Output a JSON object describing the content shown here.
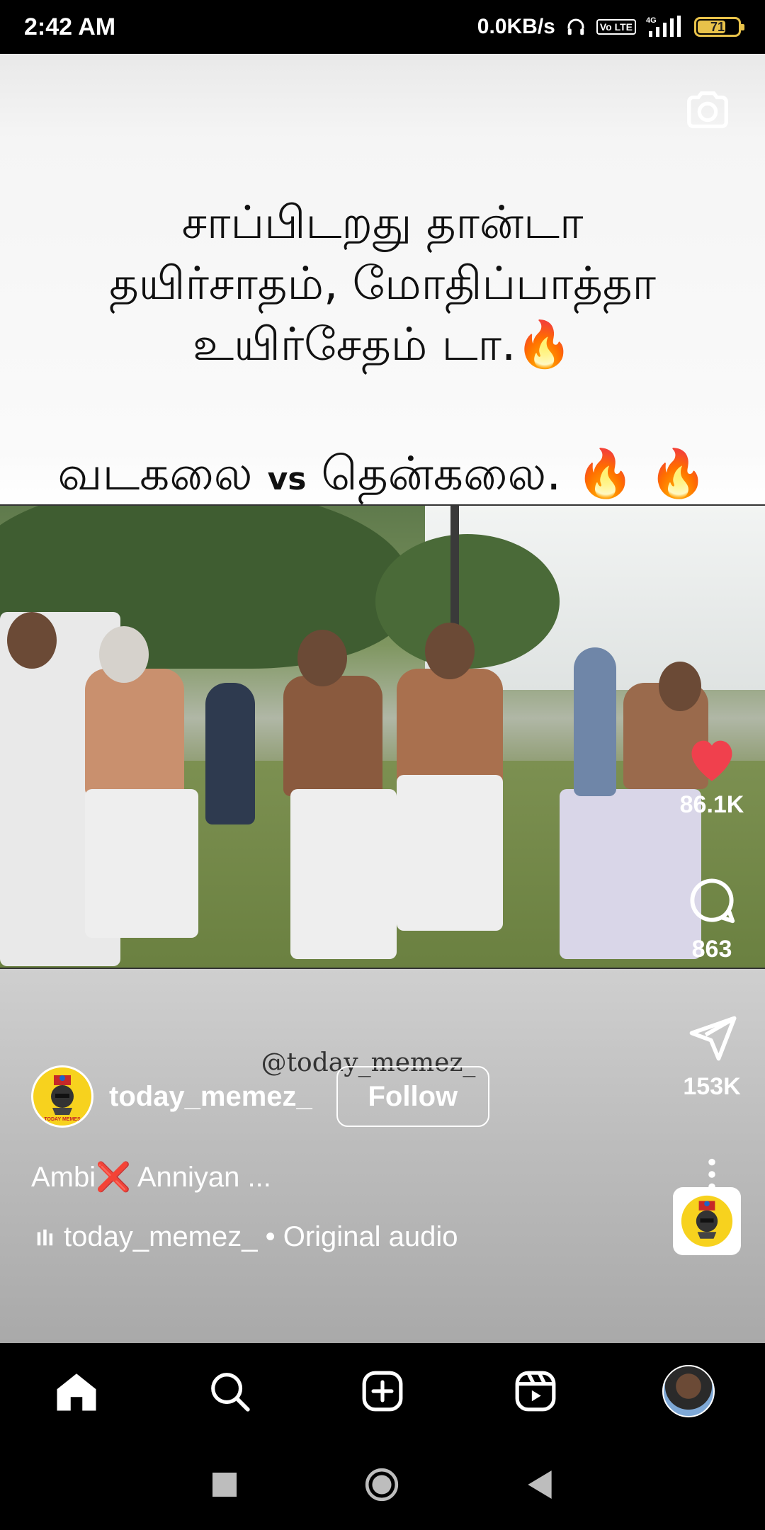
{
  "status_bar": {
    "time": "2:42 AM",
    "net_speed": "0.0KB/s",
    "volte": "Vo LTE",
    "network": "4G",
    "battery": "71",
    "battery_level": 0.71
  },
  "reel": {
    "caption_lines": [
      "சாப்பிடறது தான்டா",
      "தயிர்சாதம், மோதிப்பாத்தா",
      "உயிர்சேதம் டா."
    ],
    "caption_fire": "🔥",
    "caption_vs_left": "வடகலை",
    "caption_vs": "vs",
    "caption_vs_right": "தென்கலை.",
    "caption_vs_fire": "🔥 🔥",
    "watermark": "@today_memez_"
  },
  "actions": {
    "likes": "86.1K",
    "comments": "863",
    "shares": "153K"
  },
  "author": {
    "username": "today_memez_",
    "follow_label": "Follow",
    "avatar_text": "TODAY MEMES"
  },
  "description": {
    "text_before": "Ambi",
    "cross": "❌",
    "text_after": " Anniyan ..."
  },
  "audio": {
    "label": "today_memez_ • Original audio"
  },
  "colors": {
    "like": "#f0404d",
    "fire": "#f39410",
    "avatar_bg": "#f7d21e"
  },
  "icons": {
    "camera": "camera-icon",
    "like": "heart-icon",
    "comment": "comment-icon",
    "share": "send-icon",
    "more": "more-vertical-icon",
    "home": "home-icon",
    "search": "search-icon",
    "create": "plus-square-icon",
    "reels": "reels-icon"
  }
}
